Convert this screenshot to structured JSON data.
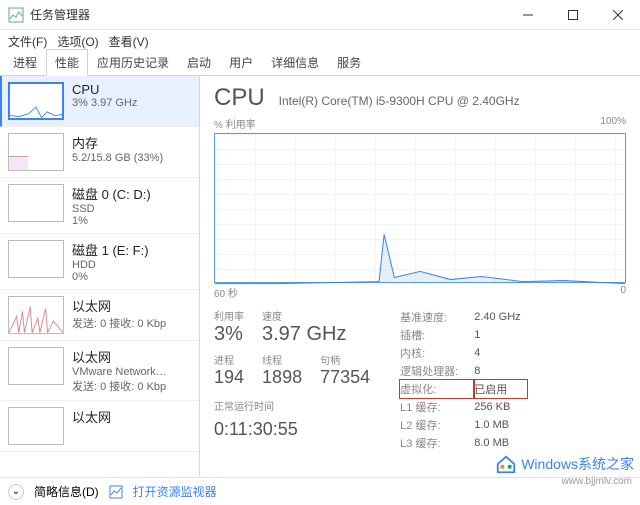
{
  "window": {
    "title": "任务管理器"
  },
  "menu": {
    "file": "文件(F)",
    "options": "选项(O)",
    "view": "查看(V)"
  },
  "tabs": [
    "进程",
    "性能",
    "应用历史记录",
    "启动",
    "用户",
    "详细信息",
    "服务"
  ],
  "active_tab": 1,
  "sidebar": [
    {
      "title": "CPU",
      "sub": "3%  3.97 GHz",
      "active": true
    },
    {
      "title": "内存",
      "sub": "5.2/15.8 GB (33%)"
    },
    {
      "title": "磁盘 0 (C: D:)",
      "sub": "SSD",
      "sub2": "1%"
    },
    {
      "title": "磁盘 1 (E: F:)",
      "sub": "HDD",
      "sub2": "0%"
    },
    {
      "title": "以太网",
      "sub": "发送: 0  接收: 0 Kbp"
    },
    {
      "title": "以太网",
      "sub": "VMware Network…",
      "sub2": "发送: 0  接收: 0 Kbp"
    },
    {
      "title": "以太网",
      "sub": ""
    }
  ],
  "main": {
    "title": "CPU",
    "sub": "Intel(R) Core(TM) i5-9300H CPU @ 2.40GHz",
    "chart_top_left": "% 利用率",
    "chart_top_right": "100%",
    "chart_bottom_left": "60 秒",
    "chart_bottom_right": "0",
    "stats_labels": {
      "util": "利用率",
      "speed": "速度",
      "proc": "进程",
      "threads": "线程",
      "handles": "句柄",
      "uptime": "正常运行时间"
    },
    "stats": {
      "util": "3%",
      "speed": "3.97 GHz",
      "proc": "194",
      "threads": "1898",
      "handles": "77354",
      "uptime": "0:11:30:55"
    },
    "right_labels": {
      "base": "基准速度:",
      "sockets": "插槽:",
      "cores": "内核:",
      "logical": "逻辑处理器:",
      "virt": "虚拟化:",
      "l1": "L1 缓存:",
      "l2": "L2 缓存:",
      "l3": "L3 缓存:"
    },
    "right": {
      "base": "2.40 GHz",
      "sockets": "1",
      "cores": "4",
      "logical": "8",
      "virt": "已启用",
      "l1": "256 KB",
      "l2": "1.0 MB",
      "l3": "8.0 MB"
    }
  },
  "footer": {
    "brief": "简略信息(D)",
    "resmon": "打开资源监视器"
  },
  "watermark": {
    "main": "Windows系统之家",
    "sub": "www.bjjmlv.com"
  },
  "chart_data": {
    "type": "line",
    "title": "% 利用率",
    "xlabel": "60 秒",
    "ylabel": "",
    "ylim": [
      0,
      100
    ],
    "x": [
      0,
      5,
      10,
      15,
      20,
      25,
      30,
      32,
      35,
      40,
      45,
      50,
      55,
      60
    ],
    "values": [
      3,
      3,
      3,
      3,
      3,
      3,
      4,
      35,
      8,
      6,
      5,
      4,
      3,
      3
    ]
  }
}
